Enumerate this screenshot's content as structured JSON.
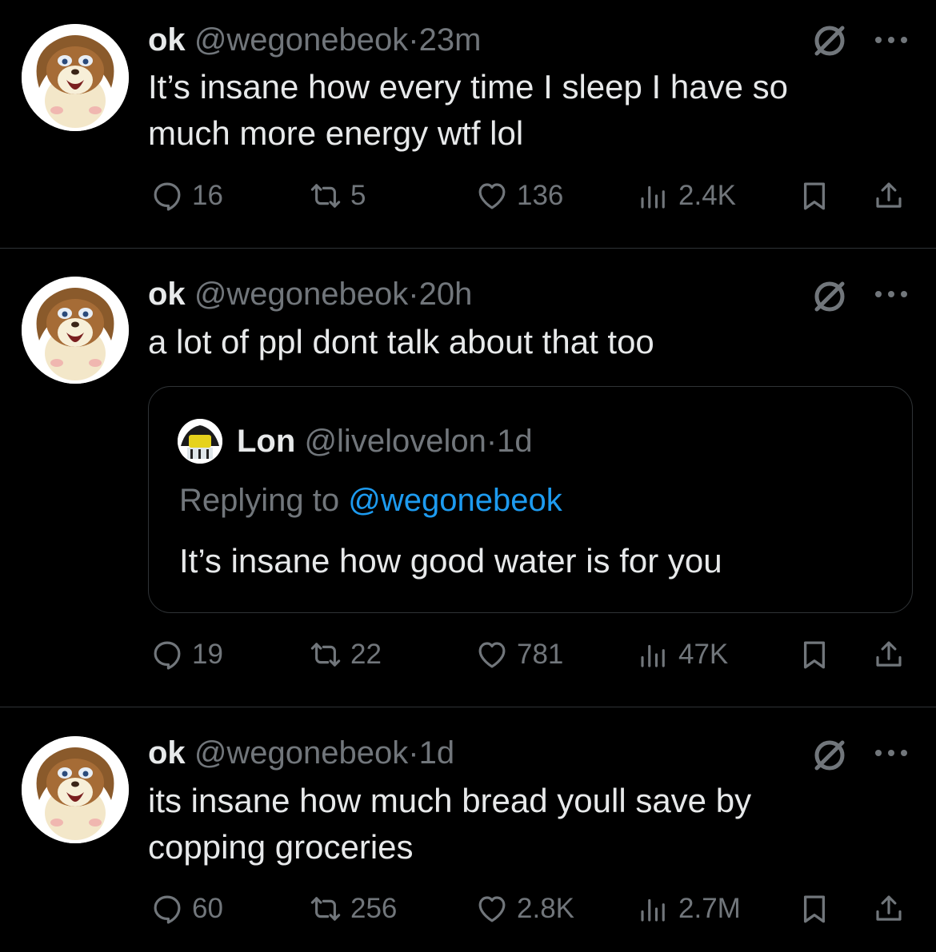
{
  "colors": {
    "background": "#000000",
    "text": "#e7e9ea",
    "muted": "#71767b",
    "link": "#1d9bf0",
    "divider": "#2f3336"
  },
  "tweets": [
    {
      "name": "ok",
      "handle": "@wegonebeok",
      "time": "23m",
      "text": "It’s insane how every time I sleep I have so much more energy wtf lol",
      "stats": {
        "replies": "16",
        "reposts": "5",
        "likes": "136",
        "views": "2.4K"
      }
    },
    {
      "name": "ok",
      "handle": "@wegonebeok",
      "time": "20h",
      "text": "a lot of ppl dont talk about that too",
      "quote": {
        "name": "Lon",
        "handle": "@livelovelon",
        "time": "1d",
        "replying_label": "Replying to",
        "replying_to": "@wegonebeok",
        "text": "It’s insane how good water is for you"
      },
      "stats": {
        "replies": "19",
        "reposts": "22",
        "likes": "781",
        "views": "47K"
      }
    },
    {
      "name": "ok",
      "handle": "@wegonebeok",
      "time": "1d",
      "text": "its insane how much bread youll save by copping groceries",
      "stats": {
        "replies": "60",
        "reposts": "256",
        "likes": "2.8K",
        "views": "2.7M"
      }
    }
  ],
  "separator": "·",
  "icons": {
    "mute": "mute-slash-icon",
    "more": "more-dots-icon",
    "reply": "reply-bubble-icon",
    "repost": "repost-icon",
    "like": "heart-icon",
    "views": "views-bar-icon",
    "bookmark": "bookmark-icon",
    "share": "share-icon"
  }
}
